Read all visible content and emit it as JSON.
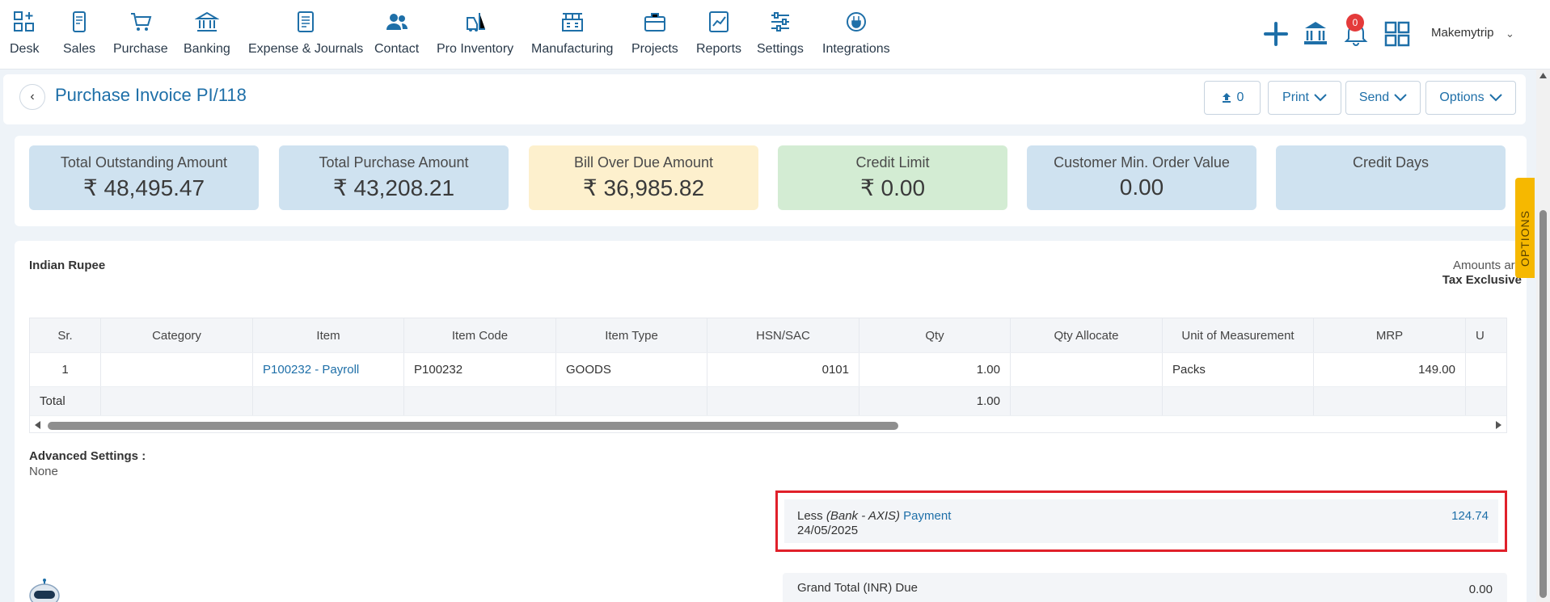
{
  "nav": {
    "items": [
      {
        "label": "Desk",
        "icon": "grid-plus-icon"
      },
      {
        "label": "Sales",
        "icon": "receipt-icon"
      },
      {
        "label": "Purchase",
        "icon": "cart-icon"
      },
      {
        "label": "Banking",
        "icon": "bank-icon"
      },
      {
        "label": "Expense & Journals",
        "icon": "journal-icon"
      },
      {
        "label": "Contact",
        "icon": "users-icon"
      },
      {
        "label": "Pro Inventory",
        "icon": "forklift-icon"
      },
      {
        "label": "Manufacturing",
        "icon": "factory-icon"
      },
      {
        "label": "Projects",
        "icon": "briefcase-icon"
      },
      {
        "label": "Reports",
        "icon": "chart-icon"
      },
      {
        "label": "Settings",
        "icon": "sliders-icon"
      },
      {
        "label": "Integrations",
        "icon": "plug-icon"
      }
    ],
    "notification_count": "0",
    "company": "Makemytrip",
    "accent": "#1e6fa8"
  },
  "header": {
    "title": "Purchase Invoice PI/118",
    "upload_count": "0",
    "print_label": "Print",
    "send_label": "Send",
    "options_label": "Options"
  },
  "cards": [
    {
      "label": "Total Outstanding Amount",
      "value": "₹ 48,495.47",
      "color": "#cfe2f0"
    },
    {
      "label": "Total Purchase Amount",
      "value": "₹ 43,208.21",
      "color": "#cfe2f0"
    },
    {
      "label": "Bill Over Due Amount",
      "value": "₹ 36,985.82",
      "color": "#fdf0cd"
    },
    {
      "label": "Credit Limit",
      "value": "₹ 0.00",
      "color": "#d3ecd3"
    },
    {
      "label": "Customer Min. Order Value",
      "value": "0.00",
      "color": "#cfe2f0"
    },
    {
      "label": "Credit Days",
      "value": "",
      "color": "#cfe2f0"
    }
  ],
  "invoice": {
    "currency": "Indian Rupee",
    "amounts_are": "Amounts are",
    "tax_mode": "Tax Exclusive",
    "columns": [
      "Sr.",
      "Category",
      "Item",
      "Item Code",
      "Item Type",
      "HSN/SAC",
      "Qty",
      "Qty Allocate",
      "Unit of Measurement",
      "MRP",
      "U"
    ],
    "rows": [
      {
        "sr": "1",
        "category": "",
        "item": "P100232 - Payroll",
        "item_code": "P100232",
        "item_type": "GOODS",
        "hsn": "0101",
        "qty": "1.00",
        "qty_allocate": "",
        "uom": "Packs",
        "mrp": "149.00"
      }
    ],
    "total_label": "Total",
    "total_qty": "1.00"
  },
  "advanced": {
    "title": "Advanced Settings :",
    "value": "None"
  },
  "payment": {
    "less": "Less",
    "bank": "(Bank - AXIS)",
    "label": "Payment",
    "date": "24/05/2025",
    "amount": "124.74"
  },
  "grand_total": {
    "label": "Grand Total (INR) Due",
    "value": "0.00"
  },
  "side_tab": "OPTIONS"
}
